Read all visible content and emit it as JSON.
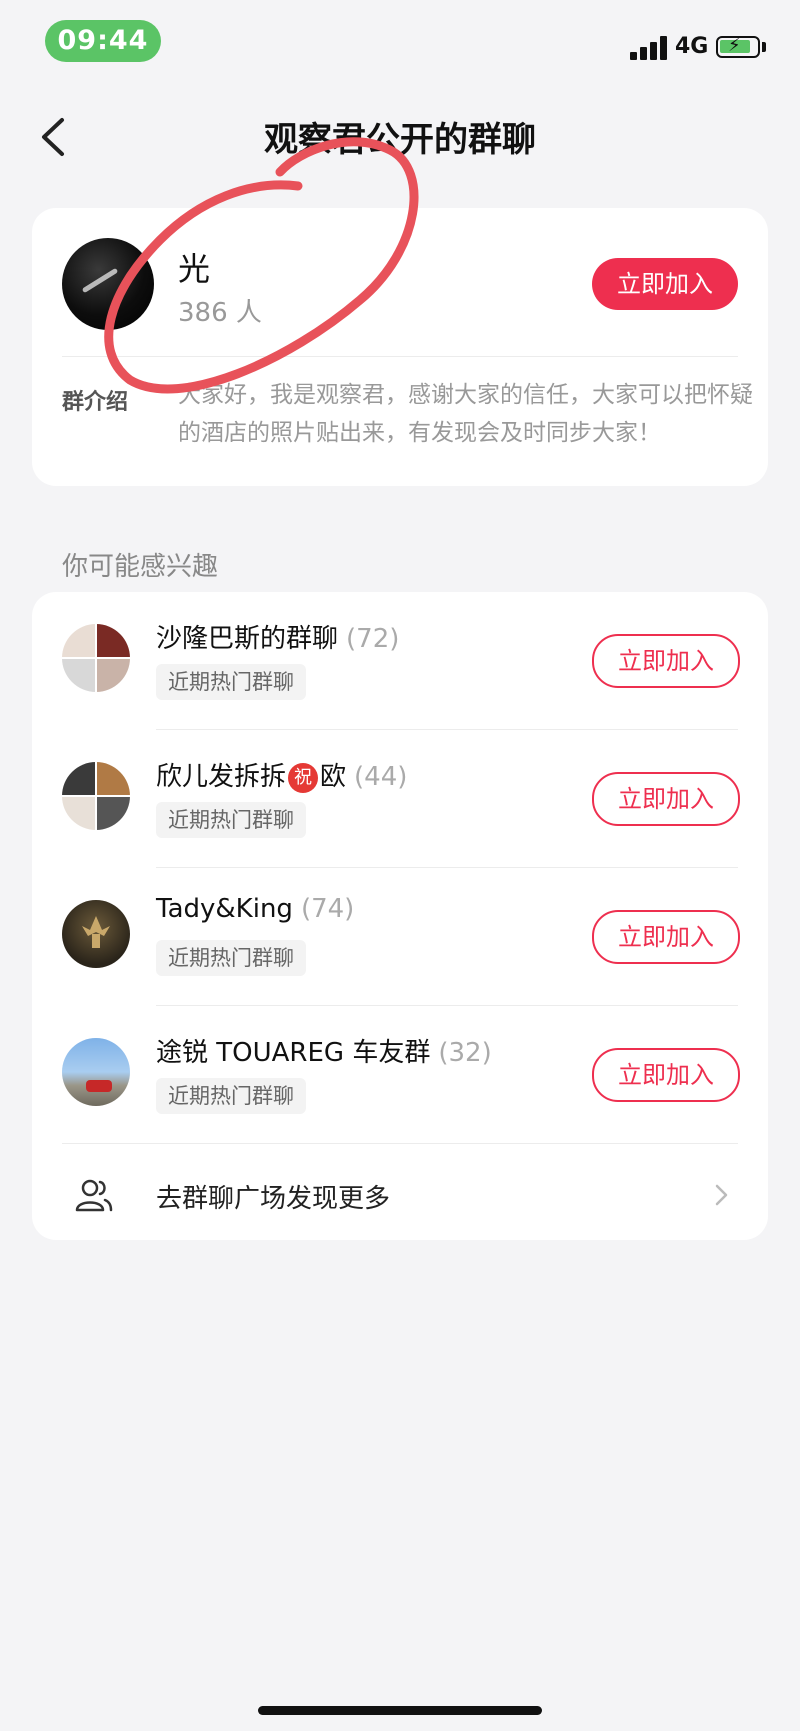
{
  "status_bar": {
    "time": "09:44",
    "network": "4G",
    "icons": [
      "signal-icon",
      "battery-charging-icon"
    ]
  },
  "nav": {
    "title": "观察君公开的群聊",
    "back_icon": "chevron-left-icon"
  },
  "main_group": {
    "name": "光",
    "members": "386 人",
    "join_label": "立即加入",
    "intro_label": "群介绍",
    "intro_text": "大家好，我是观察君，感谢大家的信任，大家可以把怀疑的酒店的照片贴出来，有发现会及时同步大家！"
  },
  "suggestions": {
    "title": "你可能感兴趣",
    "items": [
      {
        "name": "沙隆巴斯的群聊",
        "count": "(72)",
        "tag": "近期热门群聊",
        "join_label": "立即加入"
      },
      {
        "name_prefix": "欣儿发拆拆",
        "badge": "祝",
        "name_suffix": "欧",
        "count": "(44)",
        "tag": "近期热门群聊",
        "join_label": "立即加入"
      },
      {
        "name": "Tady&King",
        "count": "(74)",
        "tag": "近期热门群聊",
        "join_label": "立即加入"
      },
      {
        "name": "途锐 TOUAREG 车友群",
        "count": "(32)",
        "tag": "近期热门群聊",
        "join_label": "立即加入"
      }
    ],
    "more_label": "去群聊广场发现更多"
  },
  "colors": {
    "accent": "#ee2f4f",
    "time_pill": "#5bc466",
    "background": "#f4f4f6",
    "annotation": "#e8525a"
  }
}
